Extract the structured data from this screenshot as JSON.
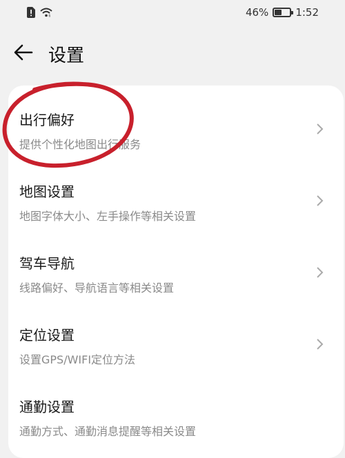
{
  "status_bar": {
    "battery_percent": "46%",
    "battery_level": 0.46,
    "time": "1:52",
    "icons": [
      "sim-alert-icon",
      "wifi-icon",
      "battery-icon"
    ]
  },
  "header": {
    "title": "设置",
    "back_icon": "arrow-left-icon"
  },
  "settings_items": [
    {
      "title": "出行偏好",
      "subtitle": "提供个性化地图出行服务"
    },
    {
      "title": "地图设置",
      "subtitle": "地图字体大小、左手操作等相关设置"
    },
    {
      "title": "驾车导航",
      "subtitle": "线路偏好、导航语言等相关设置"
    },
    {
      "title": "定位设置",
      "subtitle": "设置GPS/WIFI定位方法"
    },
    {
      "title": "通勤设置",
      "subtitle": "通勤方式、通勤消息提醒等相关设置"
    }
  ],
  "colors": {
    "background": "#f1f1f1",
    "card": "#ffffff",
    "annotation_circle": "#c8202c",
    "subtitle_text": "#8a8a8a"
  }
}
